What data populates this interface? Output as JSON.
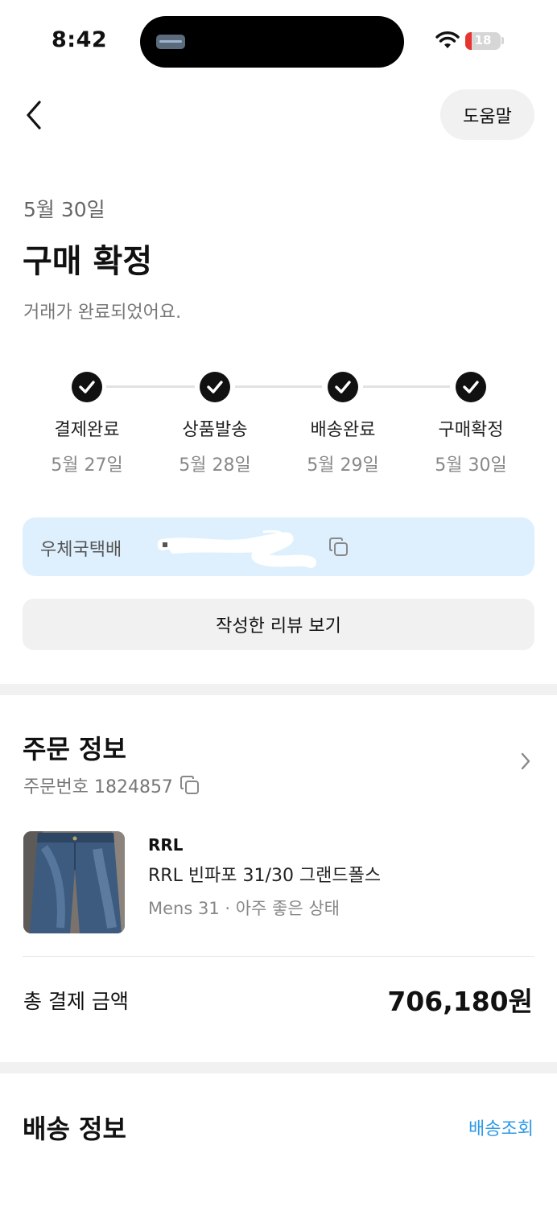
{
  "status_bar": {
    "time": "8:42",
    "battery": "18",
    "battery_level": 0.18,
    "battery_color": "#e8342f"
  },
  "nav": {
    "back_icon": "chevron-left-icon",
    "help_label": "도움말"
  },
  "header": {
    "date": "5월 30일",
    "title": "구매 확정",
    "subtitle": "거래가 완료되었어요."
  },
  "steps": [
    {
      "label": "결제완료",
      "date": "5월 27일"
    },
    {
      "label": "상품발송",
      "date": "5월 28일"
    },
    {
      "label": "배송완료",
      "date": "5월 29일"
    },
    {
      "label": "구매확정",
      "date": "5월 30일"
    }
  ],
  "tracking": {
    "carrier": "우체국택배",
    "copy_icon": "copy-icon",
    "background": "#def0fd"
  },
  "review_button": "작성한 리뷰 보기",
  "order": {
    "title": "주문 정보",
    "number": "주문번호 1824857",
    "product": {
      "brand": "RRL",
      "name": "RRL 빈파포 31/30 그랜드폴스",
      "meta": "Mens 31 · 아주 좋은 상태"
    },
    "total_label": "총 결제 금액",
    "total_amount": "706,180원"
  },
  "shipping": {
    "title": "배송 정보",
    "link": "배송조회",
    "link_color": "#2f9ae5"
  }
}
